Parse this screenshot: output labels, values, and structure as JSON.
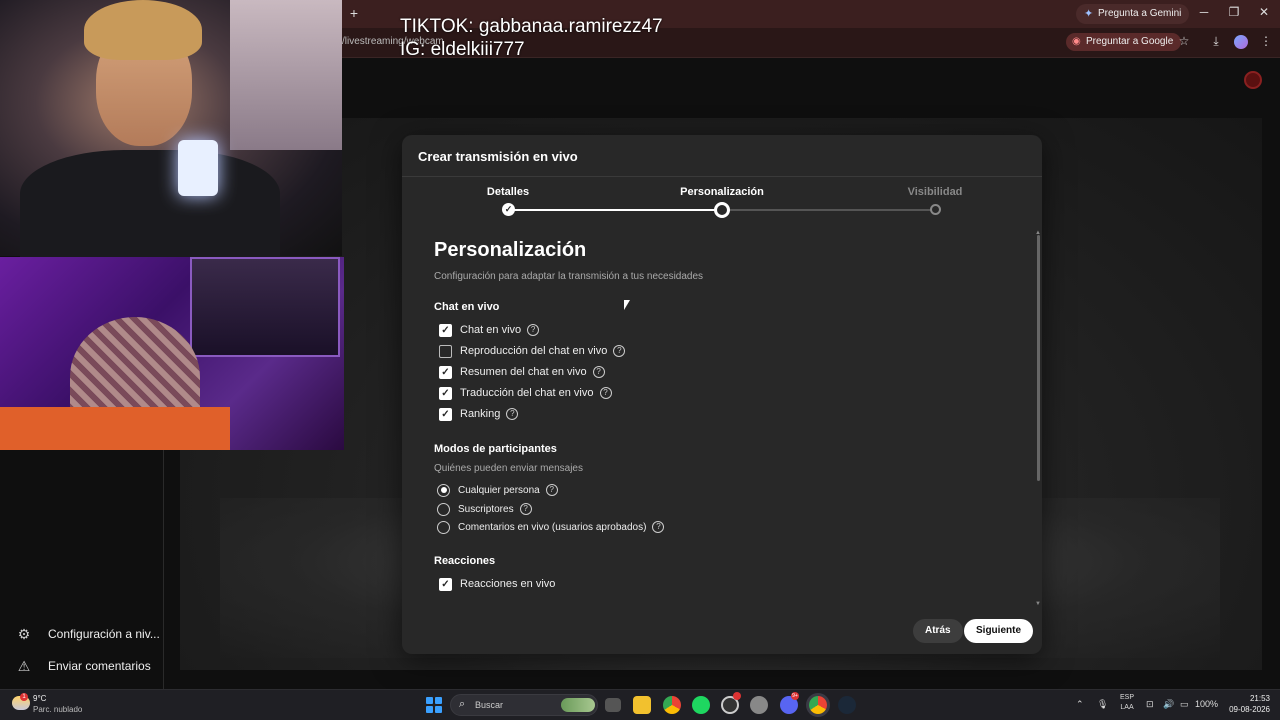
{
  "browser": {
    "new_tab_label": "+",
    "gemini_label": "Pregunta a Gemini",
    "url": "/livestreaming/webcam",
    "ask_google_label": "Preguntar a Google",
    "minimize": "─",
    "restore": "❐",
    "close": "✕",
    "star": "☆",
    "download": "⤓",
    "menu": "⋮"
  },
  "overlay": {
    "tiktok": "TIKTOK: gabbanaa.ramirezz47",
    "ig": "IG: eldelkiii777"
  },
  "sidebar": {
    "items": [
      {
        "label": "Configuración a niv...",
        "icon": "gear-icon"
      },
      {
        "label": "Enviar comentarios",
        "icon": "feedback-icon"
      }
    ]
  },
  "dialog": {
    "title": "Crear transmisión en vivo",
    "steps": [
      {
        "label": "Detalles",
        "state": "done"
      },
      {
        "label": "Personalización",
        "state": "current"
      },
      {
        "label": "Visibilidad",
        "state": "pending"
      }
    ],
    "heading": "Personalización",
    "subtitle": "Configuración para adaptar la transmisión a tus necesidades",
    "chat_section": {
      "title": "Chat en vivo",
      "options": [
        {
          "label": "Chat en vivo",
          "checked": true
        },
        {
          "label": "Reproducción del chat en vivo",
          "checked": false
        },
        {
          "label": "Resumen del chat en vivo",
          "checked": true
        },
        {
          "label": "Traducción del chat en vivo",
          "checked": true
        },
        {
          "label": "Ranking",
          "checked": true
        }
      ]
    },
    "participants_section": {
      "title": "Modos de participantes",
      "hint": "Quiénes pueden enviar mensajes",
      "options": [
        {
          "label": "Cualquier persona",
          "selected": true
        },
        {
          "label": "Suscriptores",
          "selected": false
        },
        {
          "label": "Comentarios en vivo (usuarios aprobados)",
          "selected": false
        }
      ]
    },
    "reactions_section": {
      "title": "Reacciones",
      "options": [
        {
          "label": "Reacciones en vivo",
          "checked": true
        }
      ]
    },
    "back_label": "Atrás",
    "next_label": "Siguiente"
  },
  "taskbar": {
    "weather_badge": "1",
    "temperature": "9°C",
    "condition": "Parc. nublado",
    "search_placeholder": "Buscar",
    "discord_badge": "9+",
    "lang_line1": "ESP",
    "lang_line2": "LAA",
    "battery": "100%",
    "time": "21:53",
    "date": "09-08-2026"
  },
  "colors": {
    "dialog_bg": "#282828",
    "page_bg": "#0f0f0f",
    "accent_white": "#ffffff",
    "browser_frame": "#3b1f1f"
  }
}
